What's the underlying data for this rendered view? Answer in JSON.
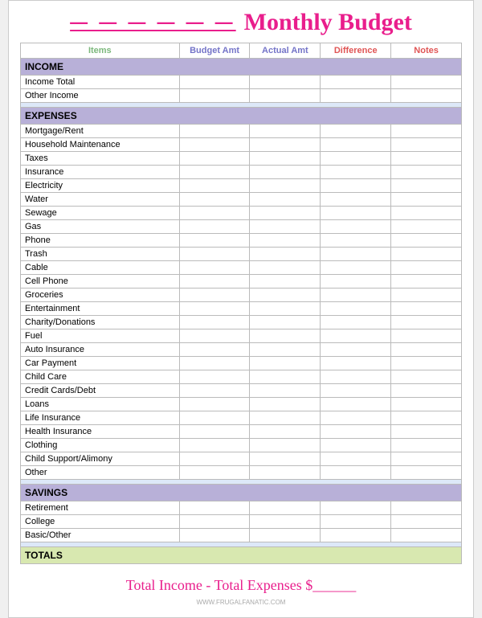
{
  "header": {
    "underline": "— — — — — —",
    "title": "Monthly Budget"
  },
  "columns": {
    "items": "Items",
    "budget": "Budget Amt",
    "actual": "Actual Amt",
    "difference": "Difference",
    "notes": "Notes"
  },
  "sections": {
    "income": {
      "label": "INCOME",
      "rows": [
        "Income Total",
        "Other Income"
      ]
    },
    "expenses": {
      "label": "EXPENSES",
      "rows": [
        "Mortgage/Rent",
        "Household Maintenance",
        "Taxes",
        "Insurance",
        "Electricity",
        "Water",
        "Sewage",
        "Gas",
        "Phone",
        "Trash",
        "Cable",
        "Cell Phone",
        "Groceries",
        "Entertainment",
        "Charity/Donations",
        "Fuel",
        "Auto Insurance",
        "Car Payment",
        "Child Care",
        "Credit Cards/Debt",
        "Loans",
        "Life Insurance",
        "Health Insurance",
        "Clothing",
        "Child Support/Alimony",
        "Other"
      ]
    },
    "savings": {
      "label": "SAVINGS",
      "rows": [
        "Retirement",
        "College",
        "Basic/Other"
      ]
    },
    "totals": {
      "label": "TOTALS"
    }
  },
  "footer": {
    "text": "Total Income - Total Expenses $______"
  },
  "watermark": "WWW.FRUGALFANATIC.COM"
}
